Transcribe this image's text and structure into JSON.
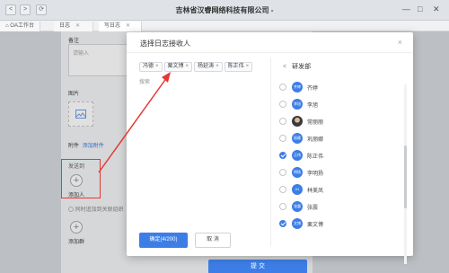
{
  "titlebar": {
    "app_title": "吉林省汉睿网络科技有限公司 -",
    "back": "<",
    "forward": ">",
    "refresh": "⟳",
    "window_controls": [
      "—",
      "□",
      "✕"
    ]
  },
  "tabs": [
    {
      "label": "OA工作台"
    },
    {
      "label": "日志",
      "close": "✕"
    },
    {
      "label": "写日志",
      "close": "✕"
    }
  ],
  "form": {
    "remark_label": "备注",
    "remark_placeholder": "请输入",
    "picture_label": "图片",
    "attachment_label": "附件",
    "attachment_link": "添加附件",
    "receiver_label": "发送到",
    "receiver_hint": "",
    "add_person": "添加人",
    "sync_label": "同时追加到关联组织",
    "add_group": "添加群",
    "submit": "提 交"
  },
  "modal": {
    "title": "选择日志接收人",
    "close": "×",
    "search_placeholder": "搜索",
    "selected": [
      {
        "name": "冯德"
      },
      {
        "name": "栗文博"
      },
      {
        "name": "杨延涛"
      },
      {
        "name": "陈正伟"
      }
    ],
    "department": "研发部",
    "members": [
      {
        "name": "齐婷",
        "avatar_text": "齐婷",
        "checked": false,
        "photo": false
      },
      {
        "name": "李旭",
        "avatar_text": "李旭",
        "checked": false,
        "photo": false
      },
      {
        "name": "常丽丽",
        "avatar_text": "",
        "checked": false,
        "photo": true
      },
      {
        "name": "巩丽娜",
        "avatar_text": "丽娜",
        "checked": false,
        "photo": false
      },
      {
        "name": "陈正伟",
        "avatar_text": "正伟",
        "checked": true,
        "photo": false
      },
      {
        "name": "李明扬",
        "avatar_text": "明扬",
        "checked": false,
        "photo": false
      },
      {
        "name": "林美凤",
        "avatar_text": "01",
        "checked": false,
        "photo": false
      },
      {
        "name": "张震",
        "avatar_text": "张震",
        "checked": false,
        "photo": false
      },
      {
        "name": "栗文博",
        "avatar_text": "文博",
        "checked": true,
        "photo": false
      }
    ],
    "confirm": "确定(4/200)",
    "cancel": "取 消"
  },
  "colors": {
    "primary": "#3d7ee6",
    "annotation_red": "#e53935"
  }
}
